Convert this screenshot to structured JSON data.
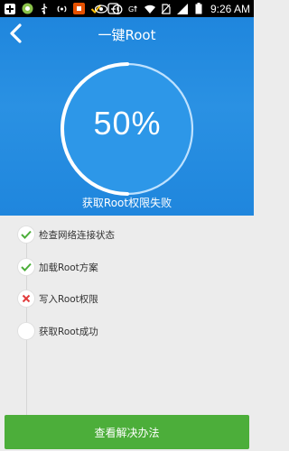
{
  "status_bar": {
    "time": "9:26 AM",
    "icons_left": [
      "add-icon",
      "app-icon",
      "usb-icon",
      "wifi-hotspot-icon",
      "app-store-icon",
      "check-icon",
      "alarm-icon"
    ],
    "icons_right": [
      "eye-icon",
      "alarm-clock-icon",
      "network-icon",
      "wifi-icon",
      "no-sim-icon",
      "signal-icon",
      "battery-icon"
    ]
  },
  "header": {
    "title": "一键Root",
    "progress_text": "50%",
    "progress_value": 0.5,
    "status": "获取Root权限失败"
  },
  "steps": [
    {
      "label": "检查网络连接状态",
      "state": "done"
    },
    {
      "label": "加载Root方案",
      "state": "done"
    },
    {
      "label": "写入Root权限",
      "state": "failed"
    },
    {
      "label": "获取Root成功",
      "state": "pending"
    }
  ],
  "bottom_button": {
    "label": "查看解决办法"
  },
  "colors": {
    "header_blue": "#1f86dd",
    "check_green": "#4cae3a",
    "fail_red": "#e23c3c",
    "button_green": "#4cae3a"
  }
}
